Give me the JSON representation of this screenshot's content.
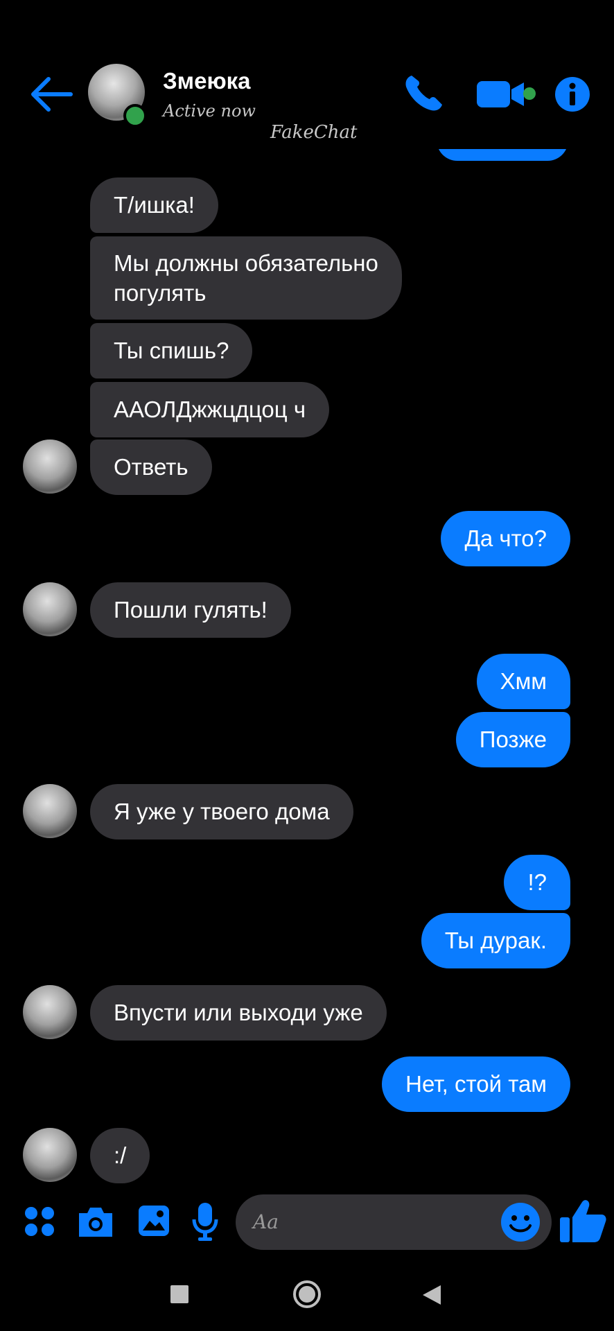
{
  "header": {
    "contact_name": "Змеюка",
    "status": "Active now",
    "watermark": "FakeChat"
  },
  "accent_color": "#0a7cff",
  "incoming_color": "#333236",
  "icons": [
    "back-arrow-icon",
    "phone-icon",
    "video-camera-icon",
    "info-icon",
    "apps-grid-icon",
    "camera-icon",
    "gallery-icon",
    "microphone-icon",
    "emoji-icon",
    "thumbs-up-icon",
    "square-nav-icon",
    "home-nav-icon",
    "back-nav-icon"
  ],
  "messages": [
    {
      "from": "them",
      "text": "Т/ишка!"
    },
    {
      "from": "them",
      "lines": [
        "Мы должны обязательно",
        "погулять"
      ]
    },
    {
      "from": "them",
      "text": "Ты спишь?"
    },
    {
      "from": "them",
      "text": "ААОЛДжжцдцоц ч"
    },
    {
      "from": "them",
      "text": "Ответь"
    },
    {
      "from": "me",
      "text": "Да что?"
    },
    {
      "from": "them",
      "text": "Пошли гулять!"
    },
    {
      "from": "me",
      "text": "Хмм"
    },
    {
      "from": "me",
      "text": "Позже"
    },
    {
      "from": "them",
      "text": "Я уже у твоего дома"
    },
    {
      "from": "me",
      "text": "!?"
    },
    {
      "from": "me",
      "text": "Ты дурак."
    },
    {
      "from": "them",
      "text": "Впусти или выходи уже"
    },
    {
      "from": "me",
      "text": "Нет, стой там"
    },
    {
      "from": "them",
      "text": ":/"
    }
  ],
  "composer": {
    "placeholder": "Aa"
  }
}
